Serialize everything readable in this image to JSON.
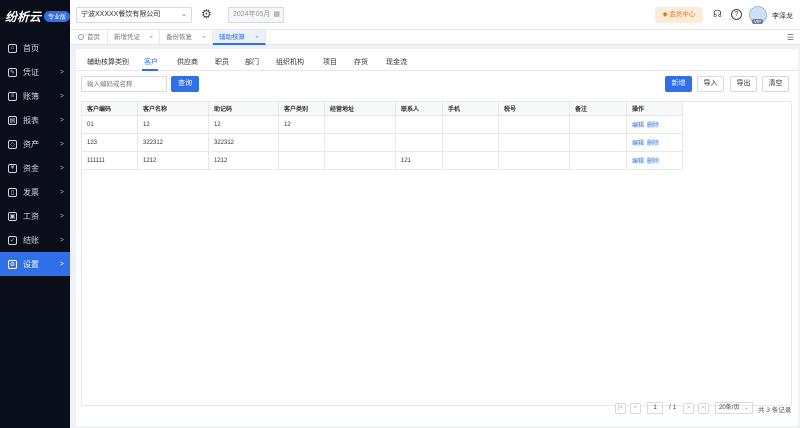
{
  "brand": {
    "name": "纷析云",
    "badge": "专业版"
  },
  "sidebar": {
    "items": [
      {
        "label": "首页",
        "icon": "home-icon",
        "arrow": ""
      },
      {
        "label": "凭证",
        "icon": "voucher-icon",
        "arrow": ">"
      },
      {
        "label": "账簿",
        "icon": "ledger-icon",
        "arrow": ">"
      },
      {
        "label": "报表",
        "icon": "report-icon",
        "arrow": ">"
      },
      {
        "label": "资产",
        "icon": "asset-icon",
        "arrow": ">"
      },
      {
        "label": "资金",
        "icon": "fund-icon",
        "arrow": ">"
      },
      {
        "label": "发票",
        "icon": "invoice-icon",
        "arrow": ">"
      },
      {
        "label": "工资",
        "icon": "salary-icon",
        "arrow": ">"
      },
      {
        "label": "结账",
        "icon": "closing-icon",
        "arrow": ">"
      },
      {
        "label": "设置",
        "icon": "settings-icon",
        "arrow": ">"
      }
    ]
  },
  "topbar": {
    "company": "宁波XXXXX餐饮有限公司",
    "period": "2024年05月",
    "member": "会员中心",
    "username": "李泽龙",
    "vip": "VIP"
  },
  "page_tabs": [
    {
      "label": "首页",
      "closable": ""
    },
    {
      "label": "新增凭证",
      "closable": "×"
    },
    {
      "label": "备份恢复",
      "closable": "×"
    },
    {
      "label": "辅助核算",
      "closable": "×"
    }
  ],
  "subtabs": [
    "辅助核算类别",
    "客户",
    "供应商",
    "职员",
    "部门",
    "组织机构",
    "项目",
    "存货",
    "现金流"
  ],
  "search": {
    "placeholder": "输入编码或名称",
    "button": "查询"
  },
  "actions": {
    "add": "新增",
    "import": "导入",
    "export": "导出",
    "clear": "清空"
  },
  "table": {
    "headers": [
      "客户编码",
      "客户名称",
      "助记码",
      "客户类别",
      "经营地址",
      "联系人",
      "手机",
      "税号",
      "备注",
      "操作"
    ],
    "rows": [
      [
        "01",
        "12",
        "12",
        "12",
        "",
        "",
        "",
        "",
        ""
      ],
      [
        "123",
        "322312",
        "322312",
        "",
        "",
        "",
        "",
        "",
        ""
      ],
      [
        "111111",
        "1212",
        "1212",
        "",
        "",
        "121",
        "",
        "",
        ""
      ]
    ],
    "row_actions": {
      "edit": "编辑",
      "delete": "删除"
    }
  },
  "pagination": {
    "first": "|<",
    "prev": "<",
    "current": "1",
    "total_pages": "/ 1",
    "next": ">",
    "last": ">|",
    "page_size": "20条/页",
    "total": "共 3 条记录"
  },
  "colors": {
    "accent": "#2f6fe8",
    "sidebar_bg": "#0a0e1a"
  }
}
